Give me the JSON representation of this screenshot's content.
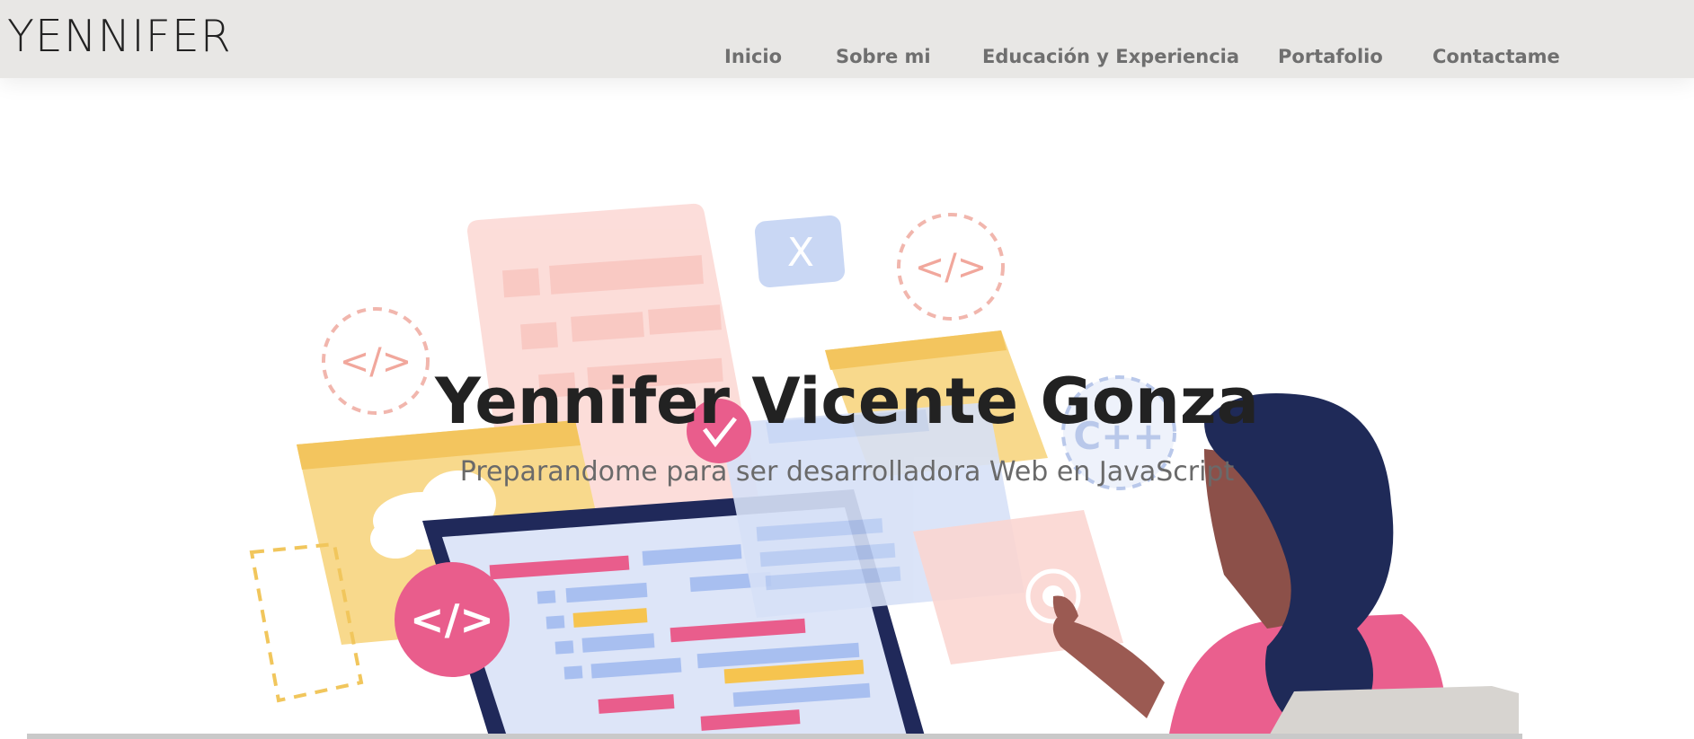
{
  "brand": "YENNIFER",
  "nav": {
    "items": [
      "Inicio",
      "Sobre mi",
      "Educación y Experiencia",
      "Portafolio",
      "Contactame"
    ]
  },
  "hero": {
    "title": "Yennifer Vicente Gonza",
    "subtitle": "Preparandome para ser desarrolladora Web en JavaScript",
    "illustration": {
      "code_badge_text": "</>",
      "cpp_badge_text": "C++",
      "close_badge_text": "X"
    }
  },
  "colors": {
    "navbar_bg": "#e8e7e5",
    "nav_text": "#6f6f6f",
    "title": "#222222",
    "subtitle": "#6a6a6a",
    "pink": "#e95d8c",
    "yellow": "#f6d27a",
    "navy": "#1f2a58",
    "blue_light": "#dbe3f6"
  }
}
